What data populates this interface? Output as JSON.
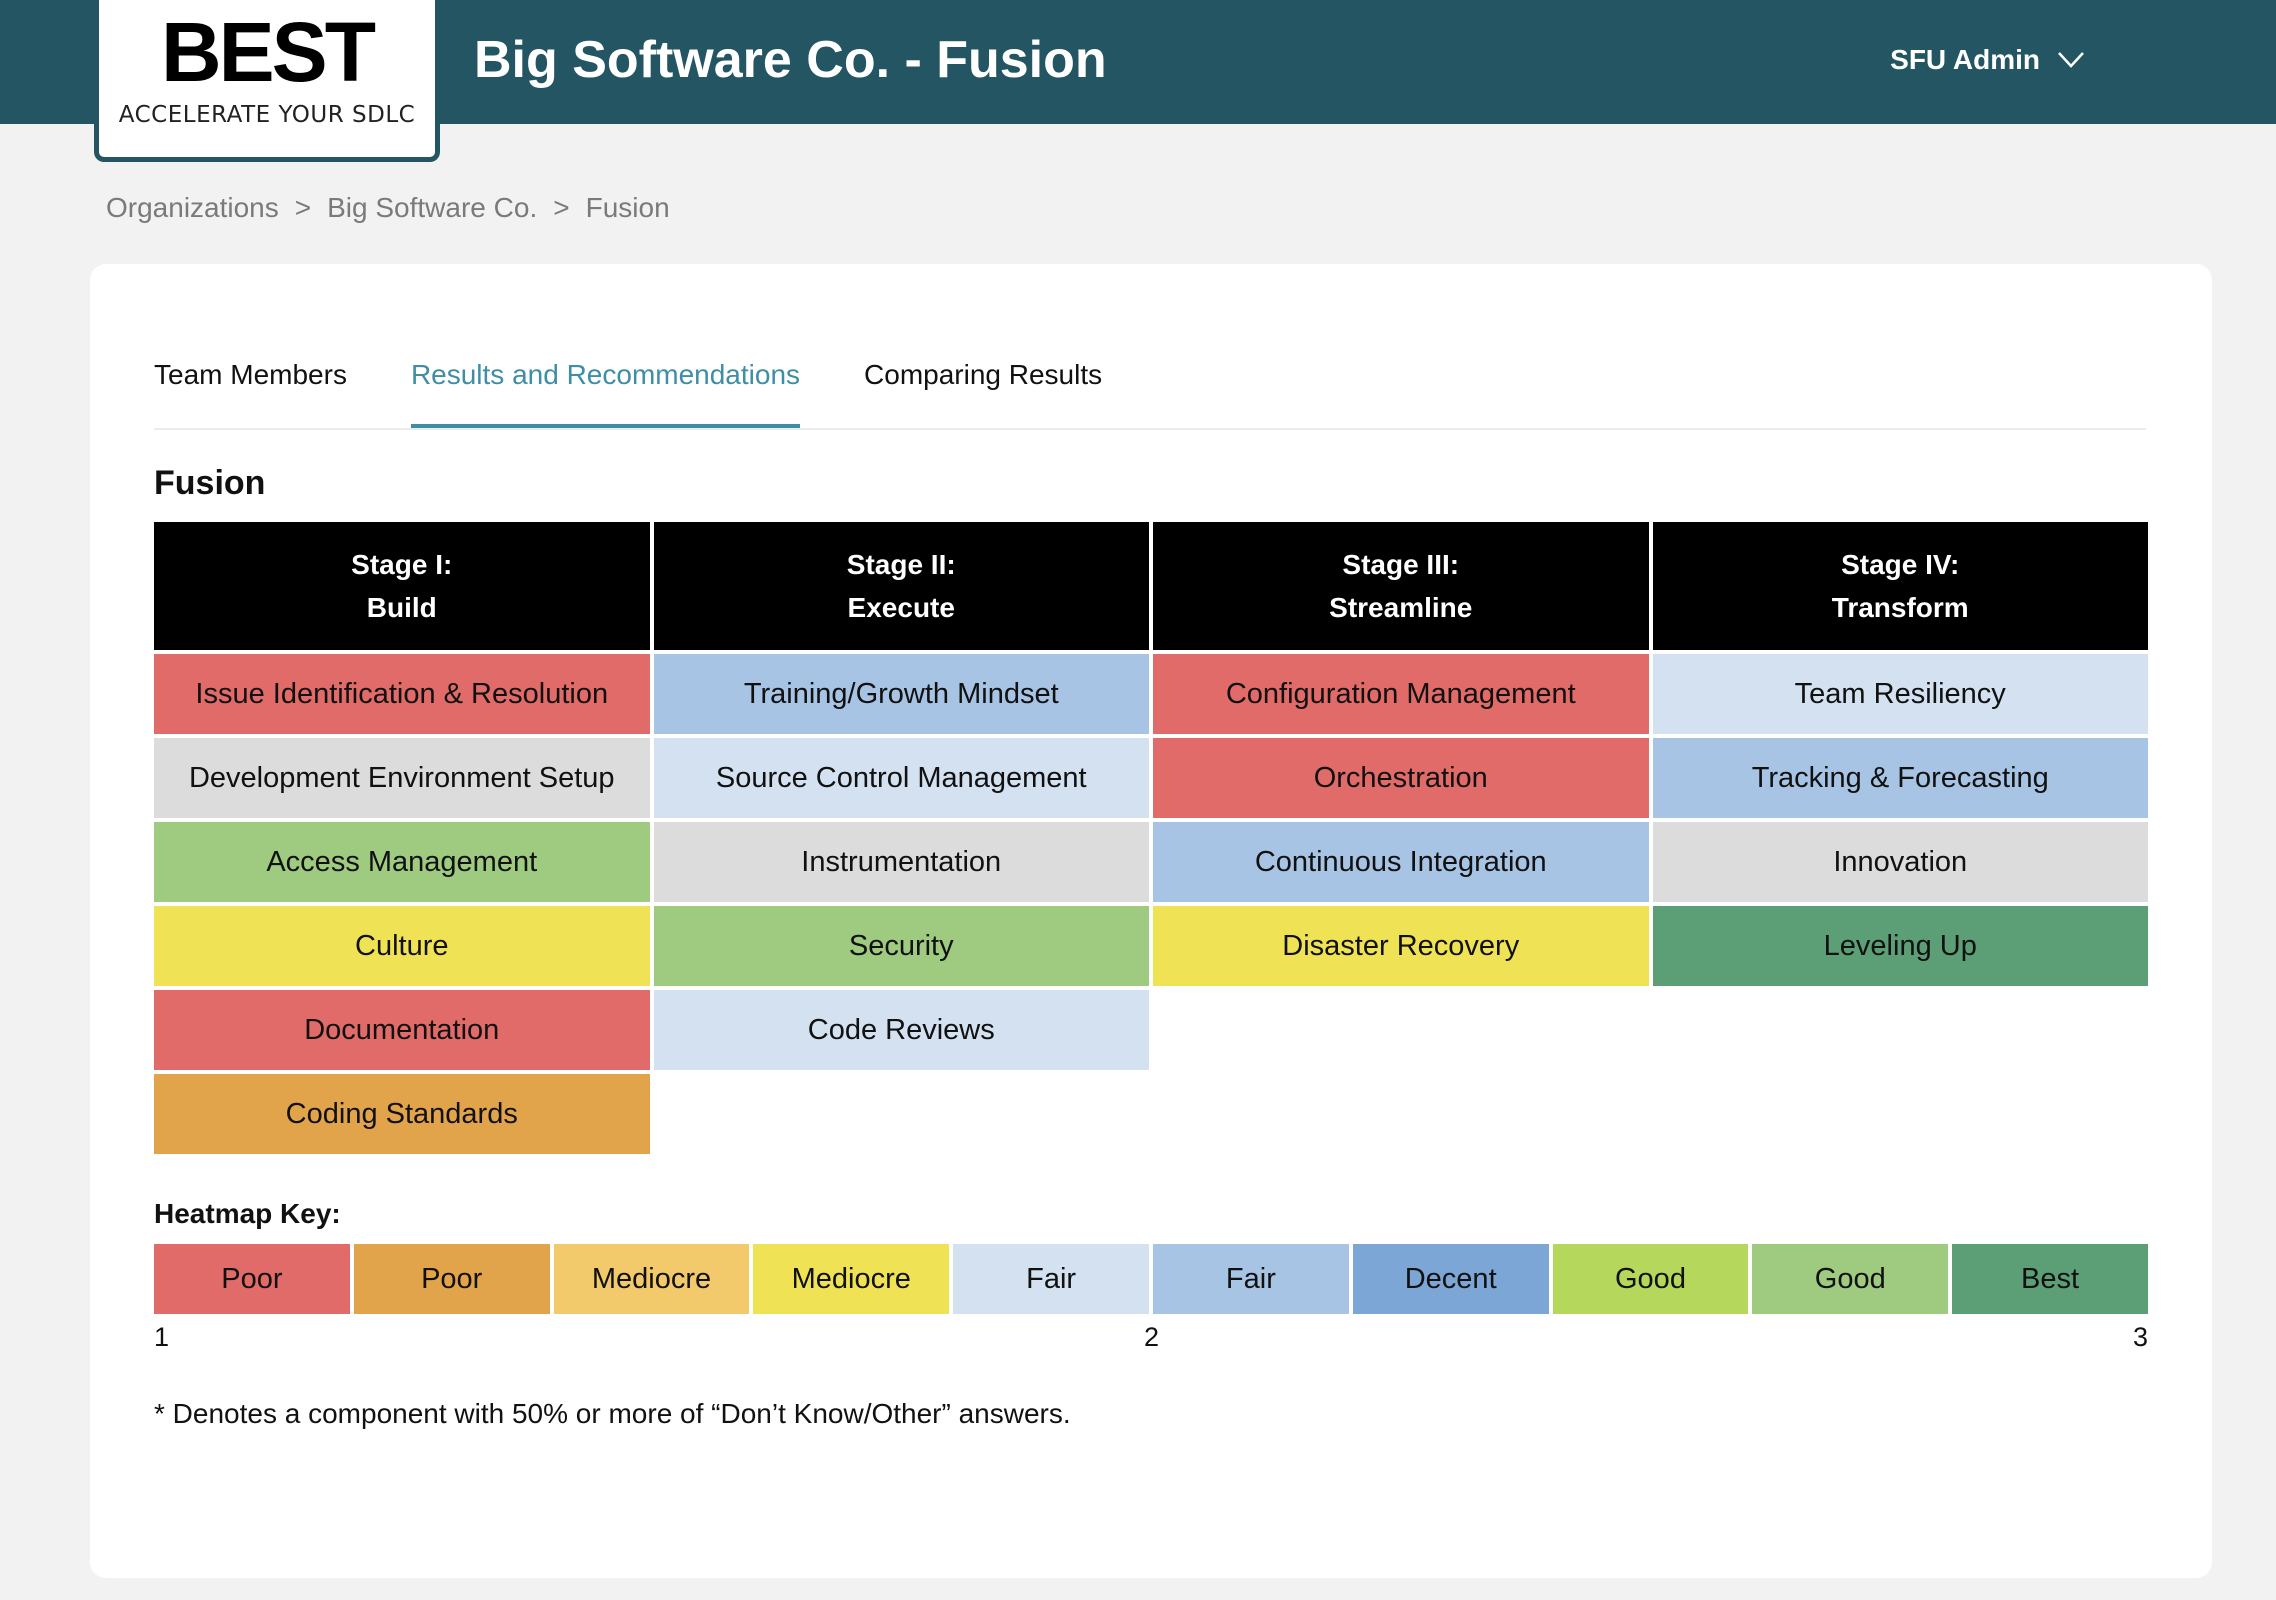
{
  "header": {
    "logo_word": "BEST",
    "logo_tagline": "ACCELERATE YOUR SDLC",
    "title": "Big Software Co. - Fusion",
    "user": "SFU Admin",
    "user_icon": "chevron-down-icon"
  },
  "breadcrumb": {
    "items": [
      "Organizations",
      "Big Software Co.",
      "Fusion"
    ],
    "separator": ">"
  },
  "tabs": {
    "items": [
      "Team Members",
      "Results and Recommendations",
      "Comparing Results"
    ],
    "active": "Results and Recommendations"
  },
  "section_title": "Fusion",
  "colors": {
    "poor_red": "#e06b69",
    "poor_orange": "#e2a44a",
    "mediocre_lightorange": "#f2c96b",
    "mediocre_yellow": "#efe355",
    "fair_lightblue": "#d3e1f1",
    "fair_blue": "#a7c4e4",
    "decent": "#7ba6d6",
    "good_lime": "#b5d75c",
    "good_green": "#9fcb80",
    "best": "#5c9f76",
    "neutral_gray": "#dcdcdc",
    "topbar": "#245563",
    "active_tab": "#3e8ea6"
  },
  "heatmap": {
    "stages": [
      {
        "line1": "Stage I:",
        "line2": "Build",
        "items": [
          {
            "label": "Issue Identification & Resolution",
            "color": "#e06b69"
          },
          {
            "label": "Development Environment Setup",
            "color": "#dcdcdc"
          },
          {
            "label": "Access Management",
            "color": "#9fcb80"
          },
          {
            "label": "Culture",
            "color": "#efe355"
          },
          {
            "label": "Documentation",
            "color": "#e06b69"
          },
          {
            "label": "Coding Standards",
            "color": "#e2a44a"
          }
        ]
      },
      {
        "line1": "Stage II:",
        "line2": "Execute",
        "items": [
          {
            "label": "Training/Growth Mindset",
            "color": "#a7c4e4"
          },
          {
            "label": "Source Control Management",
            "color": "#d3e1f1"
          },
          {
            "label": "Instrumentation",
            "color": "#dcdcdc"
          },
          {
            "label": "Security",
            "color": "#9fcb80"
          },
          {
            "label": "Code Reviews",
            "color": "#d3e1f1"
          }
        ]
      },
      {
        "line1": "Stage III:",
        "line2": "Streamline",
        "items": [
          {
            "label": "Configuration Management",
            "color": "#e06b69"
          },
          {
            "label": "Orchestration",
            "color": "#e06b69"
          },
          {
            "label": "Continuous Integration",
            "color": "#a7c4e4"
          },
          {
            "label": "Disaster Recovery",
            "color": "#efe355"
          }
        ]
      },
      {
        "line1": "Stage IV:",
        "line2": "Transform",
        "items": [
          {
            "label": "Team Resiliency",
            "color": "#d3e1f1"
          },
          {
            "label": "Tracking & Forecasting",
            "color": "#a7c4e4"
          },
          {
            "label": "Innovation",
            "color": "#dcdcdc"
          },
          {
            "label": "Leveling Up",
            "color": "#5c9f76"
          }
        ]
      }
    ]
  },
  "key": {
    "title": "Heatmap Key:",
    "items": [
      {
        "label": "Poor",
        "color": "#e06b69"
      },
      {
        "label": "Poor",
        "color": "#e2a44a"
      },
      {
        "label": "Mediocre",
        "color": "#f2c96b"
      },
      {
        "label": "Mediocre",
        "color": "#efe355"
      },
      {
        "label": "Fair",
        "color": "#d3e1f1"
      },
      {
        "label": "Fair",
        "color": "#a7c4e4"
      },
      {
        "label": "Decent",
        "color": "#7ba6d6"
      },
      {
        "label": "Good",
        "color": "#b5d75c"
      },
      {
        "label": "Good",
        "color": "#9fcb80"
      },
      {
        "label": "Best",
        "color": "#5c9f76"
      }
    ],
    "scale": [
      "1",
      "2",
      "3"
    ]
  },
  "footnote": "* Denotes a component with 50% or more of “Don’t Know/Other” answers."
}
